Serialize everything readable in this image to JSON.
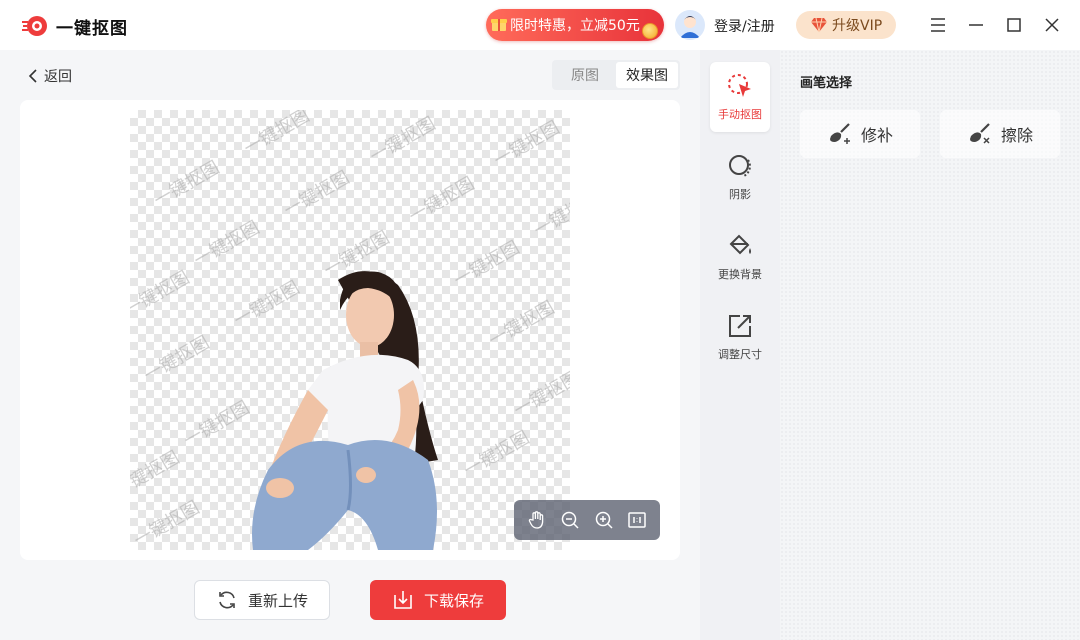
{
  "app": {
    "title": "一键抠图"
  },
  "header": {
    "promo_label": "限时特惠，立减50元",
    "login_label": "登录/注册",
    "vip_label": "升级VIP"
  },
  "main": {
    "back_label": "返回",
    "view_toggle": {
      "original_label": "原图",
      "result_label": "效果图",
      "selected": "效果图"
    },
    "watermark_text": "一键抠图",
    "reupload_label": "重新上传",
    "download_label": "下载保存"
  },
  "tools": [
    {
      "label": "手动抠图",
      "icon": "manual-cutout-icon",
      "active": true
    },
    {
      "label": "阴影",
      "icon": "shadow-icon",
      "active": false
    },
    {
      "label": "更换背景",
      "icon": "paint-bucket-icon",
      "active": false
    },
    {
      "label": "调整尺寸",
      "icon": "resize-icon",
      "active": false
    }
  ],
  "right_panel": {
    "title": "画笔选择",
    "repair_label": "修补",
    "erase_label": "擦除"
  },
  "colors": {
    "accent": "#ee3c3c",
    "vip_bg": "#fbe3cc",
    "panel_bg": "#f0f1f4"
  }
}
